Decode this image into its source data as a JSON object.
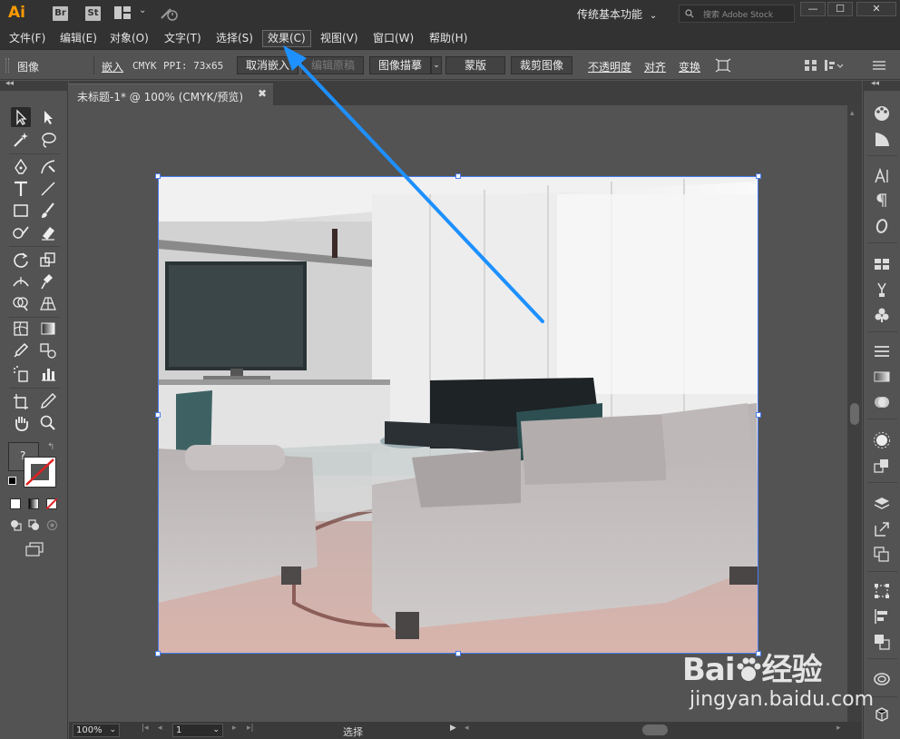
{
  "titlebar": {
    "app_logo": "Ai",
    "bridge_badge": "Br",
    "stock_badge": "St",
    "workspace": "传统基本功能",
    "search_placeholder": "搜索 Adobe Stock",
    "minimize": "—",
    "maximize": "☐",
    "close": "✕"
  },
  "menu": {
    "items": [
      {
        "label": "文件(F)"
      },
      {
        "label": "编辑(E)"
      },
      {
        "label": "对象(O)"
      },
      {
        "label": "文字(T)"
      },
      {
        "label": "选择(S)"
      },
      {
        "label": "效果(C)"
      },
      {
        "label": "视图(V)"
      },
      {
        "label": "窗口(W)"
      },
      {
        "label": "帮助(H)"
      }
    ],
    "active": "效果(C)"
  },
  "controlbar": {
    "object_type": "图像",
    "embed_label": "嵌入",
    "color_mode": "CMYK",
    "ppi": "PPI: 73x65",
    "unembed_button": "取消嵌入",
    "edit_original_button": "编辑原稿",
    "image_trace_button": "图像描摹",
    "mask_button": "蒙版",
    "crop_button": "裁剪图像",
    "opacity_link": "不透明度",
    "align_link": "对齐",
    "transform_link": "变换"
  },
  "document": {
    "tab_title": "未标题-1* @ 100% (CMYK/预览)",
    "tab_close": "✖"
  },
  "statusbar": {
    "zoom": "100%",
    "page": "1",
    "status": "选择"
  },
  "lefttools": {
    "collapse": "◂◂",
    "color_help": "?"
  },
  "rightdock": {
    "collapse": "◂◂"
  },
  "watermark": {
    "brand": "Bai",
    "brand_suffix": "经验",
    "url": "jingyan.baidu.com"
  },
  "colors": {
    "accent_arrow": "#1e90ff",
    "selection": "#4a7df0",
    "app_logo": "#ff9a00"
  }
}
